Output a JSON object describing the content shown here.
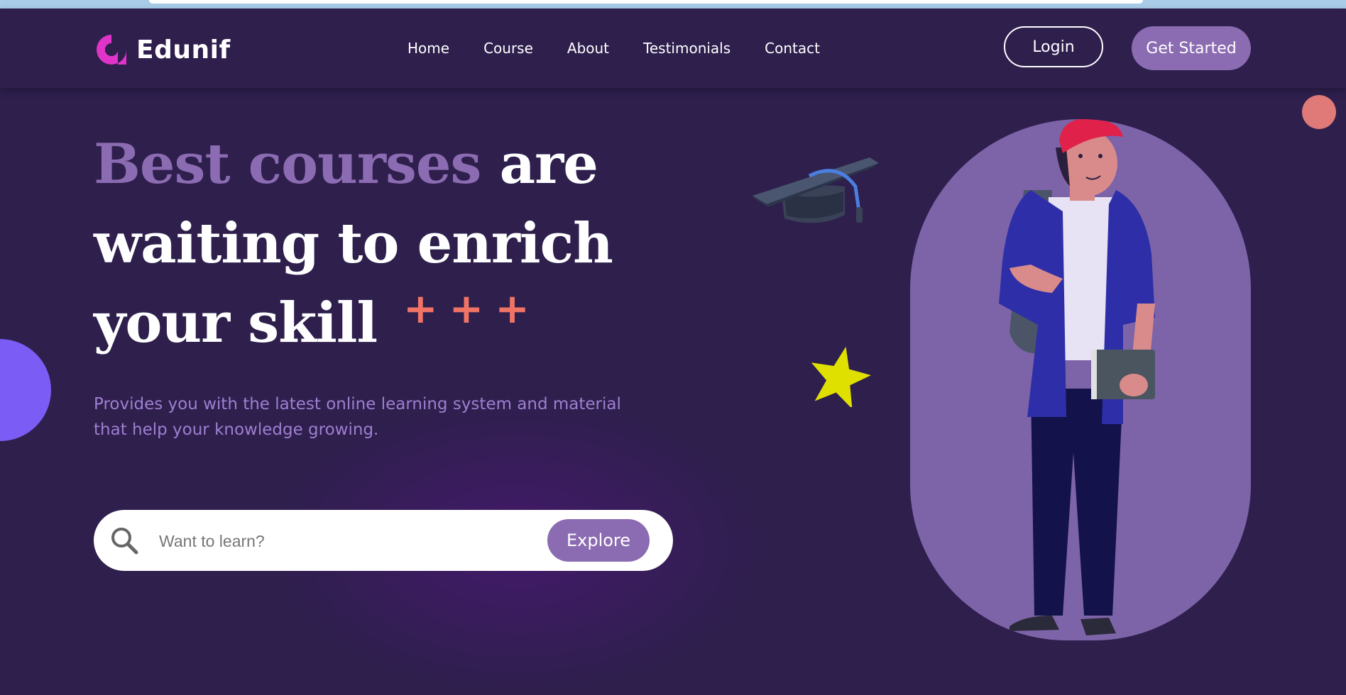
{
  "brand": {
    "name": "Edunif"
  },
  "nav": {
    "links": [
      "Home",
      "Course",
      "About",
      "Testimonials",
      "Contact"
    ],
    "login": "Login",
    "get_started": "Get Started"
  },
  "hero": {
    "title_accent": "Best courses",
    "title_rest_1": " are",
    "title_line2": "waiting to enrich",
    "title_line3": "your skill",
    "subtitle": "Provides you with the latest online learning system and material that help your knowledge growing."
  },
  "search": {
    "placeholder": "Want to learn?",
    "button": "Explore"
  },
  "colors": {
    "background": "#2e1f4d",
    "accent": "#8b6bb1",
    "plus": "#f07466",
    "star": "#e0e000"
  },
  "icons": [
    "logo-icon",
    "search-icon",
    "graduation-cap-icon",
    "star-icon"
  ]
}
